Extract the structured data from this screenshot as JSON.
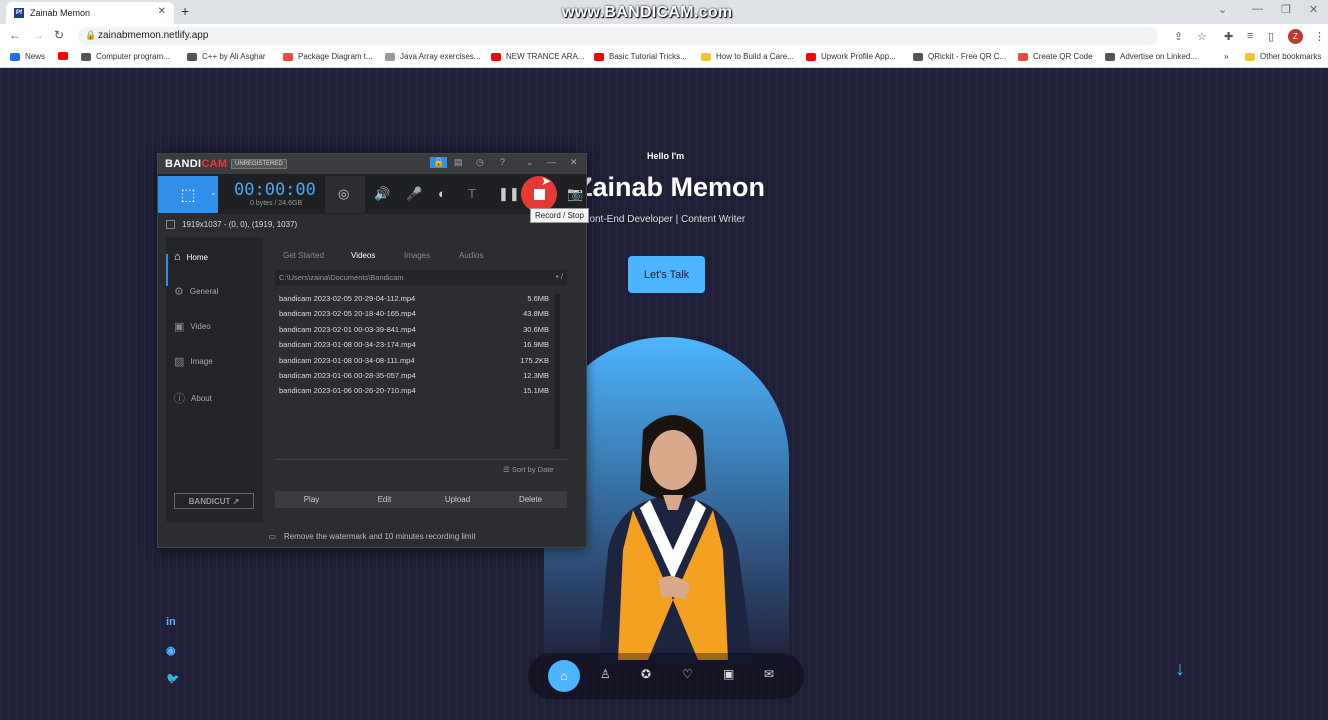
{
  "browser": {
    "tab_title": "Zainab Memon",
    "tab_favicon": "Pf",
    "new_tab": "+",
    "watermark": "www.BANDICAM.com",
    "url": "zainabmemon.netlify.app",
    "avatar_letter": "Z",
    "bookmarks": [
      {
        "label": "News",
        "color": "#1a73e8"
      },
      {
        "label": "",
        "color": "#ff0000"
      },
      {
        "label": "Computer program...",
        "color": "#555555"
      },
      {
        "label": "C++ by Ali Asghar",
        "color": "#555555"
      },
      {
        "label": "Package Diagram t...",
        "color": "#e74c3c"
      },
      {
        "label": "Java Array exercises...",
        "color": "#999999"
      },
      {
        "label": "NEW TRANCE ARA...",
        "color": "#ff0000"
      },
      {
        "label": "Basic Tutorial Tricks...",
        "color": "#ff0000"
      },
      {
        "label": "How to Build a Care...",
        "color": "#f4c430"
      },
      {
        "label": "Upwork Profile App...",
        "color": "#ff0000"
      },
      {
        "label": "QRickit - Free QR C...",
        "color": "#555555"
      },
      {
        "label": "Create QR Code",
        "color": "#e74c3c"
      },
      {
        "label": "Advertise on Linked...",
        "color": "#555555"
      }
    ],
    "bookmarks_more": "»",
    "other_bookmarks": "Other bookmarks"
  },
  "site": {
    "hello": "Hello I'm",
    "name": "Zainab Memon",
    "role": "Front-End Developer | Content Writer",
    "cta": "Let's Talk",
    "accent": "#4db5ff"
  },
  "bandicam": {
    "logo_a": "BANDI",
    "logo_b": "CAM",
    "unregistered": "UNREGISTERED",
    "timer": "00:00:00",
    "bytes": "0 bytes / 24.6GB",
    "tooltip": "Record / Stop",
    "region": "1919x1037 - (0, 0), (1919, 1037)",
    "sidebar": [
      "Home",
      "General",
      "Video",
      "Image",
      "About"
    ],
    "bandicut": "BANDICUT ↗",
    "tabs": [
      "Get Started",
      "Videos",
      "Images",
      "Audios"
    ],
    "path": "C:\\Users\\zaina\\Documents\\Bandicam",
    "path_extra": "/",
    "files": [
      {
        "name": "bandicam 2023-02-05 20-29-04-112.mp4",
        "size": "5.6MB"
      },
      {
        "name": "bandicam 2023-02-05 20-18-40-165.mp4",
        "size": "43.8MB"
      },
      {
        "name": "bandicam 2023-02-01 00-03-39-841.mp4",
        "size": "30.6MB"
      },
      {
        "name": "bandicam 2023-01-08 00-34-23-174.mp4",
        "size": "16.9MB"
      },
      {
        "name": "bandicam 2023-01-08 00-34-08-111.mp4",
        "size": "175.2KB"
      },
      {
        "name": "bandicam 2023-01-06 00-28-35-057.mp4",
        "size": "12.3MB"
      },
      {
        "name": "bandicam 2023-01-06 00-26-20-710.mp4",
        "size": "15.1MB"
      }
    ],
    "sort": "Sort by Date",
    "actions": [
      "Play",
      "Edit",
      "Upload",
      "Delete"
    ],
    "footer": "Remove the watermark and 10 minutes recording limit"
  }
}
